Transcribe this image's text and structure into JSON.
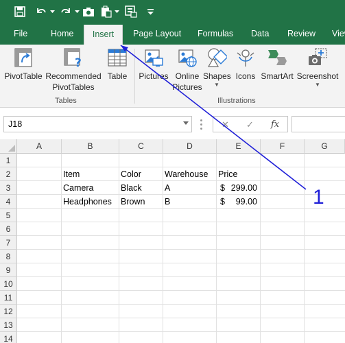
{
  "colors": {
    "brand": "#217346",
    "ribbon_bg": "#f3f3f3",
    "annotation": "#2020d8"
  },
  "qat": {
    "icons": [
      "save-icon",
      "undo-icon",
      "redo-icon",
      "camera-icon",
      "paste-special-icon",
      "form-icon",
      "customize-icon"
    ]
  },
  "tabs": [
    "File",
    "Home",
    "Insert",
    "Page Layout",
    "Formulas",
    "Data",
    "Review",
    "View"
  ],
  "active_tab": "Insert",
  "ribbon": {
    "groups": {
      "tables": "Tables",
      "illustrations": "Illustrations"
    },
    "buttons": {
      "pivottable": "PivotTable",
      "recommended_1": "Recommended",
      "recommended_2": "PivotTables",
      "table": "Table",
      "pictures": "Pictures",
      "online_1": "Online",
      "online_2": "Pictures",
      "shapes": "Shapes",
      "icons": "Icons",
      "smartart": "SmartArt",
      "screenshot": "Screenshot"
    }
  },
  "formula_bar": {
    "name_box": "J18",
    "fx": "fx",
    "cancel": "✕",
    "enter": "✓",
    "value": ""
  },
  "grid": {
    "columns": [
      "A",
      "B",
      "C",
      "D",
      "E",
      "F",
      "G"
    ],
    "rows": [
      "1",
      "2",
      "3",
      "4",
      "5",
      "6",
      "7",
      "8",
      "9",
      "10",
      "11",
      "12",
      "13",
      "14"
    ],
    "header": {
      "item": "Item",
      "color": "Color",
      "warehouse": "Warehouse",
      "price": "Price"
    },
    "data": [
      {
        "item": "Camera",
        "color": "Black",
        "warehouse": "A",
        "currency": "$",
        "price": "299.00"
      },
      {
        "item": "Headphones",
        "color": "Brown",
        "warehouse": "B",
        "currency": "$",
        "price": "99.00"
      }
    ]
  },
  "annotation": {
    "label": "1"
  }
}
